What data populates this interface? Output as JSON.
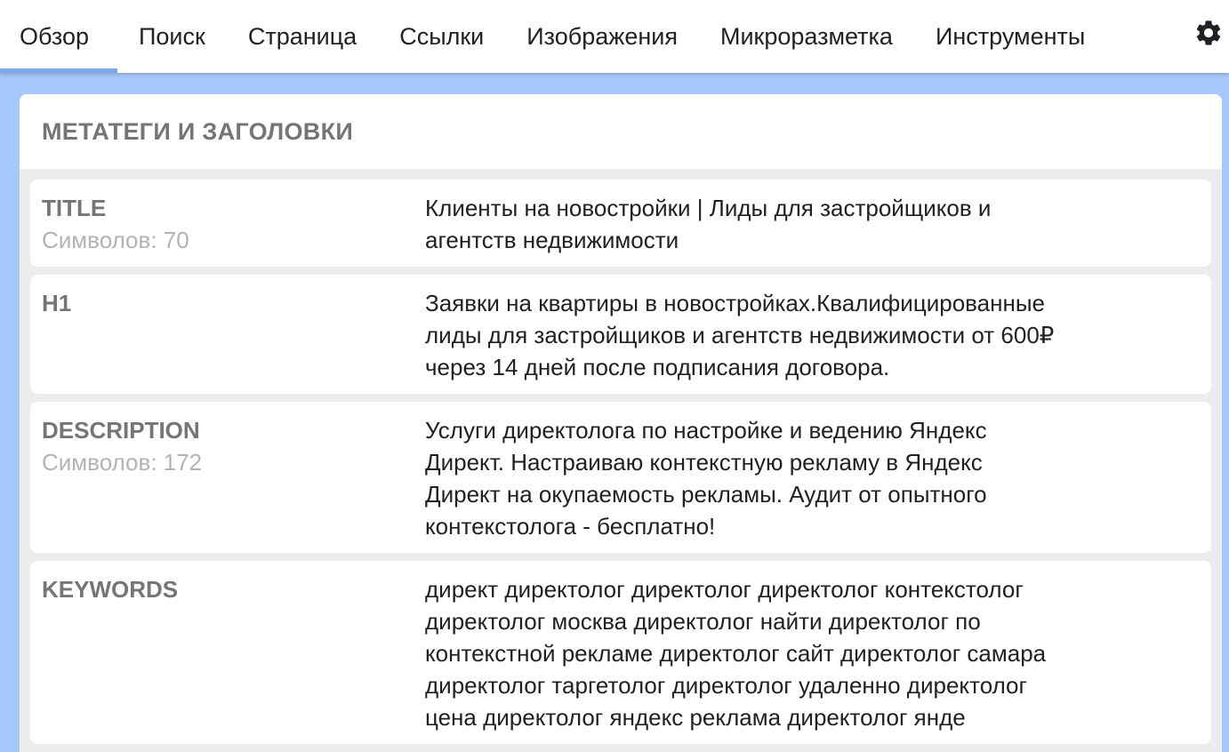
{
  "tabs": [
    {
      "id": "overview",
      "label": "Обзор",
      "active": true
    },
    {
      "id": "search",
      "label": "Поиск",
      "active": false
    },
    {
      "id": "page",
      "label": "Страница",
      "active": false
    },
    {
      "id": "links",
      "label": "Ссылки",
      "active": false
    },
    {
      "id": "images",
      "label": "Изображения",
      "active": false
    },
    {
      "id": "markup",
      "label": "Микроразметка",
      "active": false
    },
    {
      "id": "tools",
      "label": "Инструменты",
      "active": false
    }
  ],
  "settings_icon": "gear-icon",
  "colors": {
    "page_background": "#a8c7fa",
    "active_tab_indicator": "#7ea7ee",
    "label_text": "#757575",
    "count_text": "#b3b3b3"
  },
  "card": {
    "title": "МЕТАТЕГИ И ЗАГОЛОВКИ",
    "rows": [
      {
        "name": "TITLE",
        "count": "Символов: 70",
        "lines": [
          "Клиенты на новостройки | Лиды для застройщиков и",
          "агентств недвижимости"
        ]
      },
      {
        "name": "H1",
        "count": "",
        "lines": [
          "Заявки на квартиры в новостройках.Квалифицированные",
          "лиды для застройщиков и агентств недвижимости от 600₽",
          "через 14 дней после подписания договора."
        ]
      },
      {
        "name": "DESCRIPTION",
        "count": "Символов: 172",
        "lines": [
          "Услуги директолога по настройке и ведению Яндекс",
          "Директ. Настраиваю контекстную рекламу в Яндекс",
          "Директ на окупаемость рекламы. Аудит от опытного",
          "контекстолога - бесплатно!"
        ]
      },
      {
        "name": "KEYWORDS",
        "count": "",
        "lines": [
          "директ директолог директолог директолог контекстолог",
          "директолог москва директолог найти директолог по",
          "контекстной рекламе директолог сайт директолог самара",
          "директолог таргетолог директолог удаленно директолог",
          "цена директолог яндекс реклама директолог янде"
        ]
      }
    ]
  }
}
